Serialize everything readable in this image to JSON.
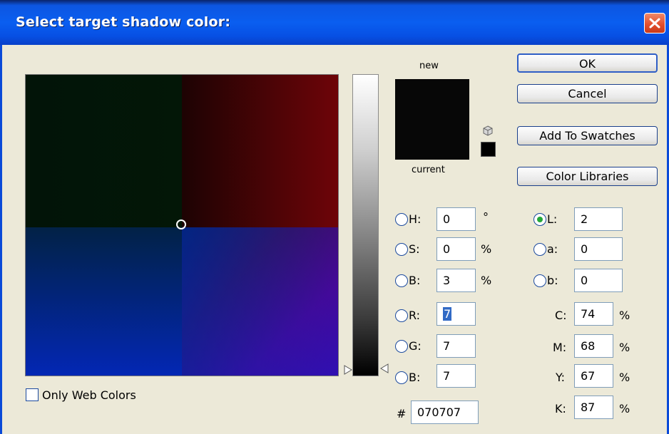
{
  "dialog": {
    "title": "Select target shadow color:"
  },
  "preview": {
    "new_label": "new",
    "current_label": "current",
    "new_color": "#070707",
    "current_color": "#070707"
  },
  "buttons": {
    "ok": "OK",
    "cancel": "Cancel",
    "add_swatches": "Add To Swatches",
    "color_libraries": "Color Libraries"
  },
  "hsb": {
    "h": {
      "label": "H:",
      "value": "0",
      "unit": "°"
    },
    "s": {
      "label": "S:",
      "value": "0",
      "unit": "%"
    },
    "b": {
      "label": "B:",
      "value": "3",
      "unit": "%"
    }
  },
  "rgb": {
    "r": {
      "label": "R:",
      "value": "7"
    },
    "g": {
      "label": "G:",
      "value": "7"
    },
    "b": {
      "label": "B:",
      "value": "7"
    }
  },
  "hex": {
    "label": "#",
    "value": "070707"
  },
  "lab": {
    "l": {
      "label": "L:",
      "value": "2",
      "selected": true
    },
    "a": {
      "label": "a:",
      "value": "0"
    },
    "b": {
      "label": "b:",
      "value": "0"
    }
  },
  "cmyk": {
    "c": {
      "label": "C:",
      "value": "74",
      "unit": "%"
    },
    "m": {
      "label": "M:",
      "value": "68",
      "unit": "%"
    },
    "y": {
      "label": "Y:",
      "value": "67",
      "unit": "%"
    },
    "k": {
      "label": "K:",
      "value": "87",
      "unit": "%"
    }
  },
  "options": {
    "only_web_colors": "Only Web Colors",
    "only_web_colors_checked": false
  },
  "icons": {
    "close": "close-icon",
    "cube": "cube-icon",
    "slider_arrow": "triangle-arrow-icon"
  }
}
